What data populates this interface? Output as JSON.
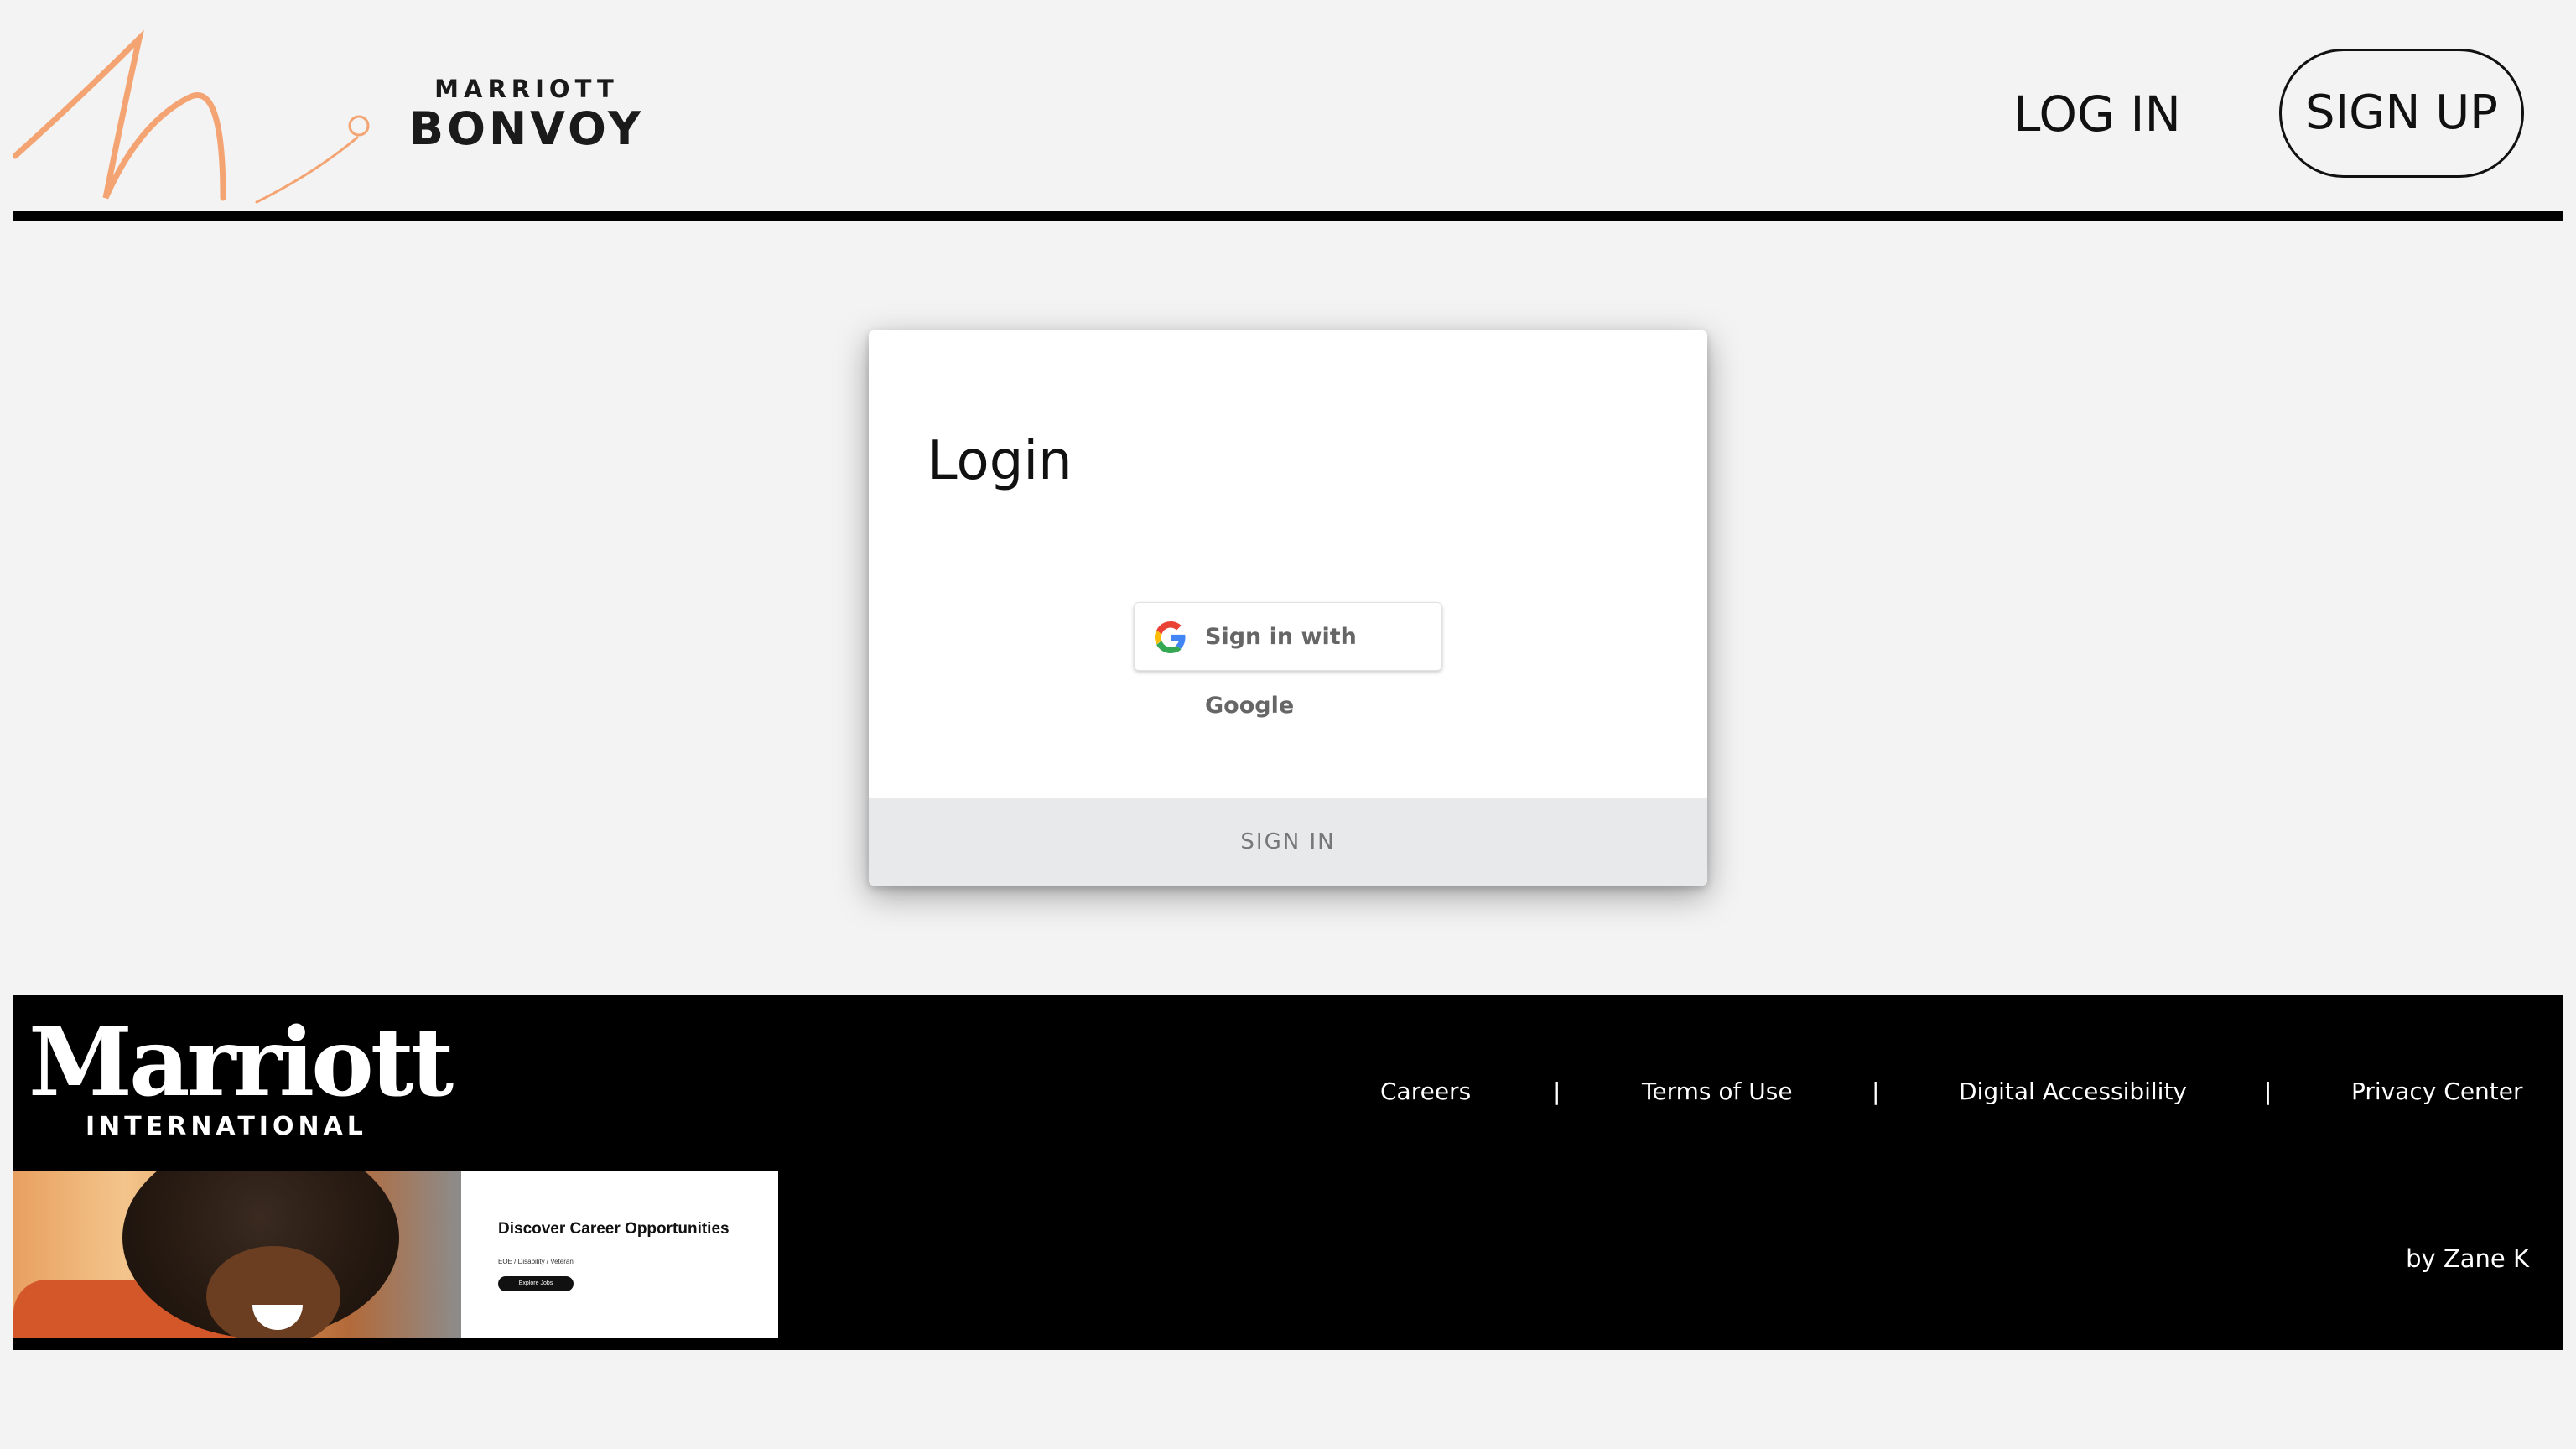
{
  "header": {
    "brand_top": "MARRIOTT",
    "brand_bottom": "BONVOY",
    "nav_login": "LOG IN",
    "nav_signup": "SIGN UP",
    "accent_color": "#f4a472"
  },
  "login_card": {
    "title": "Login",
    "google_button_label": "Sign in with Google",
    "submit_label": "SIGN IN"
  },
  "footer": {
    "logo_word": "Marriott",
    "logo_sub": "INTERNATIONAL",
    "links": [
      "Careers",
      "Terms of Use",
      "Digital Accessibility",
      "Privacy Center"
    ],
    "separator": "|",
    "credit": "by Zane K",
    "ad": {
      "title": "Discover Career Opportunities",
      "subtitle": "EOE / Disability / Veteran",
      "button": "Explore Jobs"
    }
  }
}
